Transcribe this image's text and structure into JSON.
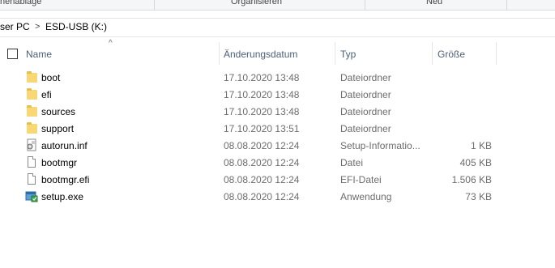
{
  "ribbon": {
    "groups": [
      "nenablage",
      "Organisieren",
      "Neu"
    ]
  },
  "address": {
    "crumb1": "ser PC",
    "crumb2": "ESD-USB (K:)",
    "separator": ">"
  },
  "columns": {
    "name": "Name",
    "date": "Änderungsdatum",
    "type": "Typ",
    "size": "Größe"
  },
  "files": [
    {
      "name": "boot",
      "date": "17.10.2020 13:48",
      "type": "Dateiordner",
      "size": "",
      "icon": "folder-icon"
    },
    {
      "name": "efi",
      "date": "17.10.2020 13:48",
      "type": "Dateiordner",
      "size": "",
      "icon": "folder-icon"
    },
    {
      "name": "sources",
      "date": "17.10.2020 13:48",
      "type": "Dateiordner",
      "size": "",
      "icon": "folder-icon"
    },
    {
      "name": "support",
      "date": "17.10.2020 13:51",
      "type": "Dateiordner",
      "size": "",
      "icon": "folder-icon"
    },
    {
      "name": "autorun.inf",
      "date": "08.08.2020 12:24",
      "type": "Setup-Informatio...",
      "size": "1 KB",
      "icon": "setup-info-icon"
    },
    {
      "name": "bootmgr",
      "date": "08.08.2020 12:24",
      "type": "Datei",
      "size": "405 KB",
      "icon": "file-icon"
    },
    {
      "name": "bootmgr.efi",
      "date": "08.08.2020 12:24",
      "type": "EFI-Datei",
      "size": "1.506 KB",
      "icon": "file-icon"
    },
    {
      "name": "setup.exe",
      "date": "08.08.2020 12:24",
      "type": "Anwendung",
      "size": "73 KB",
      "icon": "setup-exe-icon"
    }
  ],
  "colors": {
    "folder": "#f8d775",
    "header_text": "#4c607a",
    "secondary_text": "#6d6d6d"
  }
}
